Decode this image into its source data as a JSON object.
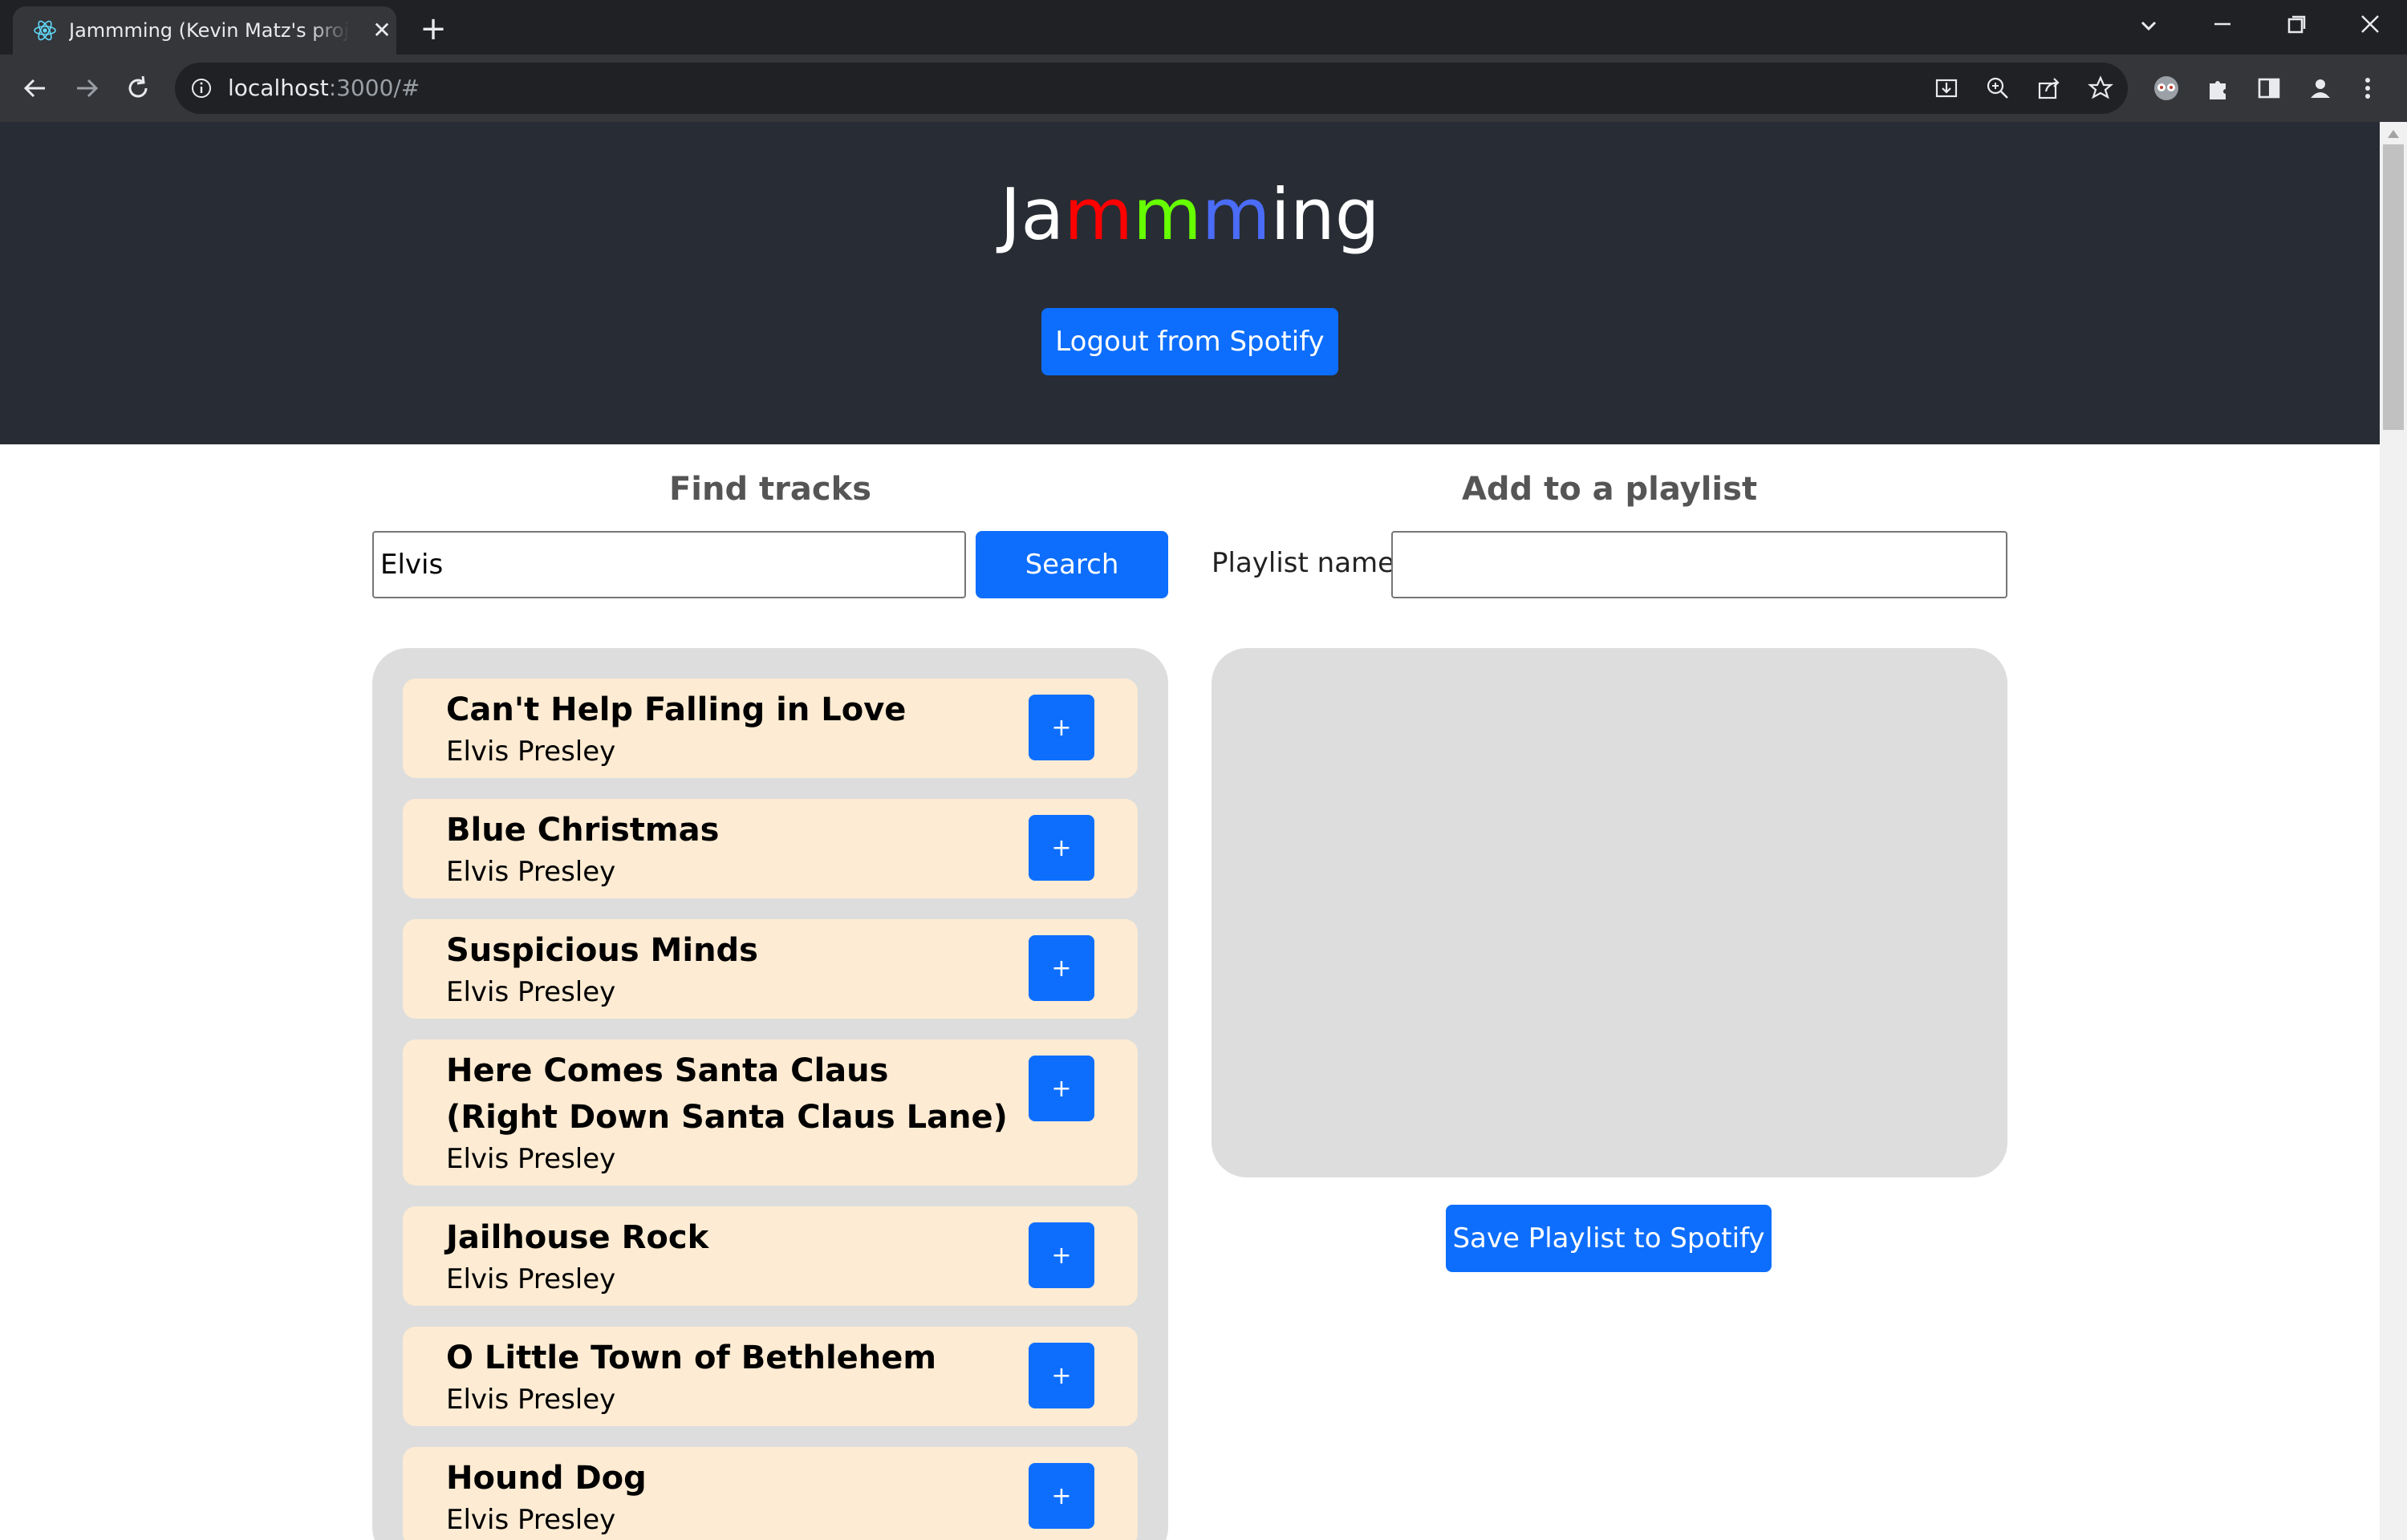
{
  "browser": {
    "tab_title": "Jammming (Kevin Matz's project)",
    "url_host": "localhost",
    "url_rest": ":3000/#"
  },
  "header": {
    "title_parts": [
      "Ja",
      "m",
      "m",
      "m",
      "ing"
    ],
    "logout_label": "Logout from Spotify"
  },
  "search": {
    "heading": "Find tracks",
    "input_value": "Elvis",
    "button_label": "Search"
  },
  "playlist": {
    "heading": "Add to a playlist",
    "name_label": "Playlist name",
    "name_value": "",
    "save_label": "Save Playlist to Spotify"
  },
  "results": {
    "add_label": "+",
    "tracks": [
      {
        "name": "Can't Help Falling in Love",
        "artist": "Elvis Presley"
      },
      {
        "name": "Blue Christmas",
        "artist": "Elvis Presley"
      },
      {
        "name": "Suspicious Minds",
        "artist": "Elvis Presley"
      },
      {
        "name": "Here Comes Santa Claus (Right Down Santa Claus Lane)",
        "artist": "Elvis Presley"
      },
      {
        "name": "Jailhouse Rock",
        "artist": "Elvis Presley"
      },
      {
        "name": "O Little Town of Bethlehem",
        "artist": "Elvis Presley"
      },
      {
        "name": "Hound Dog",
        "artist": "Elvis Presley"
      }
    ]
  },
  "colors": {
    "header_bg": "#282c34",
    "accent_blue": "#0d6efd",
    "title_red": "#ff0000",
    "title_green": "#66ff00",
    "title_blue": "#4a6cf7",
    "track_bg": "#fdebd3",
    "panel_bg": "#dddddd"
  }
}
